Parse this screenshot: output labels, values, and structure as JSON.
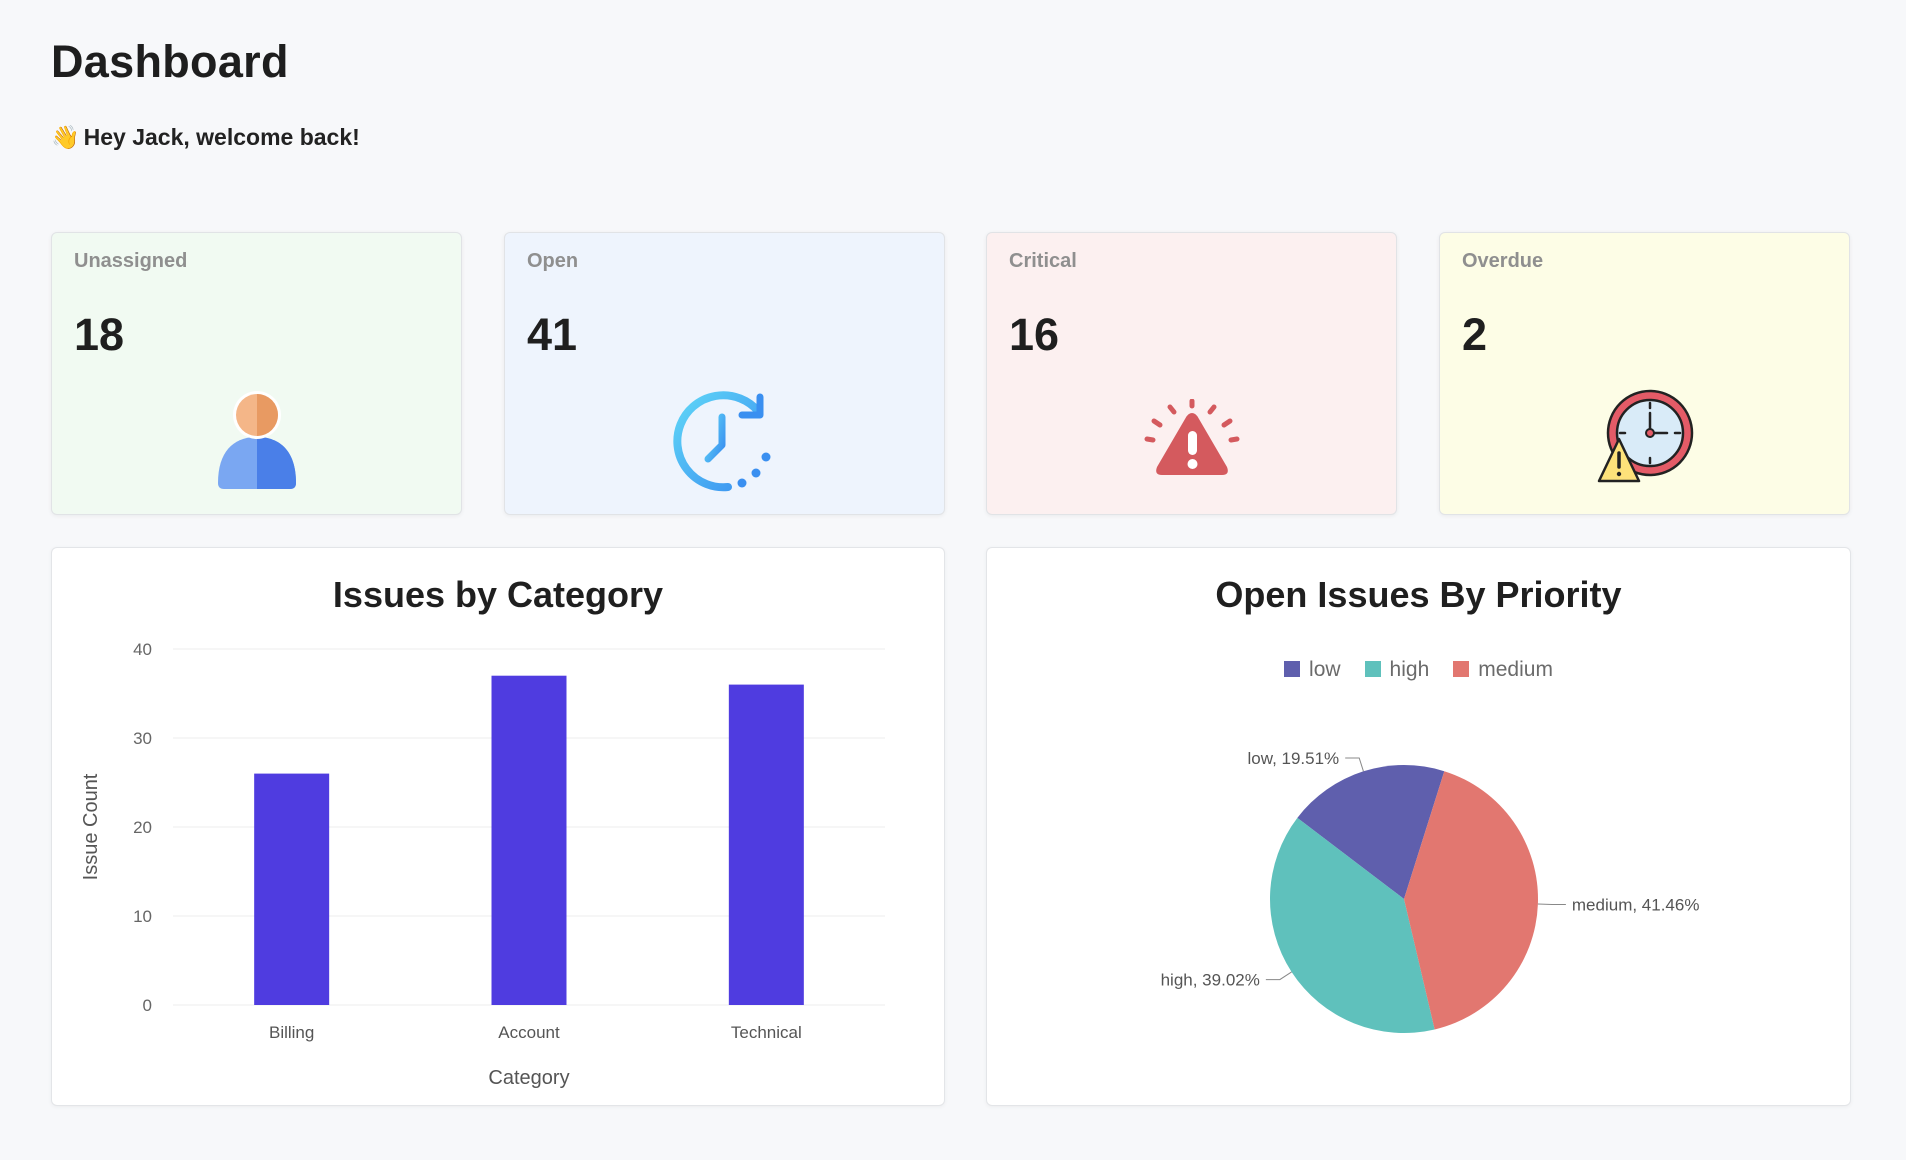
{
  "header": {
    "title": "Dashboard",
    "greeting_emoji": "👋",
    "greeting": "Hey Jack, welcome back!"
  },
  "stats": [
    {
      "label": "Unassigned",
      "value": "18",
      "icon": "user-icon",
      "bg": "#f1faf2"
    },
    {
      "label": "Open",
      "value": "41",
      "icon": "clock-refresh-icon",
      "bg": "#eef4fd"
    },
    {
      "label": "Critical",
      "value": "16",
      "icon": "alert-siren-icon",
      "bg": "#fcf0f0"
    },
    {
      "label": "Overdue",
      "value": "2",
      "icon": "clock-warning-icon",
      "bg": "#fdfde6"
    }
  ],
  "charts": {
    "category": {
      "title": "Issues by Category",
      "xlabel": "Category",
      "ylabel": "Issue Count"
    },
    "priority": {
      "title": "Open Issues By Priority"
    }
  },
  "chart_data": [
    {
      "type": "bar",
      "title": "Issues by Category",
      "xlabel": "Category",
      "ylabel": "Issue Count",
      "categories": [
        "Billing",
        "Account",
        "Technical"
      ],
      "values": [
        26,
        37,
        36
      ],
      "ylim": [
        0,
        40
      ],
      "yticks": [
        0,
        10,
        20,
        30,
        40
      ],
      "grid": true,
      "color": "#4f3ce0"
    },
    {
      "type": "pie",
      "title": "Open Issues By Priority",
      "legend_position": "top",
      "slices": [
        {
          "label": "low",
          "value": 19.51,
          "display": "low, 19.51%",
          "color": "#5f5fad"
        },
        {
          "label": "high",
          "value": 39.02,
          "display": "high, 39.02%",
          "color": "#5fc1bc"
        },
        {
          "label": "medium",
          "value": 41.46,
          "display": "medium, 41.46%",
          "color": "#e27770"
        }
      ]
    }
  ]
}
